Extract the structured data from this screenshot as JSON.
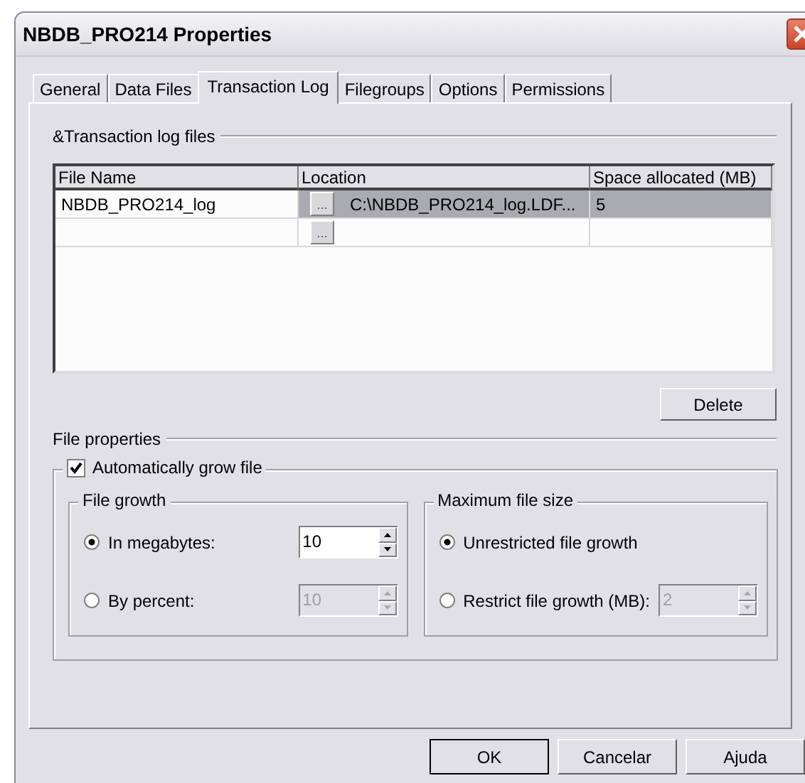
{
  "window": {
    "title": "NBDB_PRO214 Properties"
  },
  "tabs": [
    {
      "label": "General",
      "selected": false
    },
    {
      "label": "Data Files",
      "selected": false
    },
    {
      "label": "Transaction Log",
      "selected": true
    },
    {
      "label": "Filegroups",
      "selected": false
    },
    {
      "label": "Options",
      "selected": false
    },
    {
      "label": "Permissions",
      "selected": false
    }
  ],
  "log_files": {
    "label": "&Transaction log files",
    "columns": [
      "File Name",
      "Location",
      "Space allocated (MB)"
    ],
    "rows": [
      {
        "file_name": "NBDB_PRO214_log",
        "browse": "...",
        "location": "C:\\NBDB_PRO214_log.LDF...",
        "space": "5",
        "selected": true
      },
      {
        "browse": "...",
        "selected": false
      }
    ]
  },
  "delete_button": "Delete",
  "file_properties": {
    "label": "File properties",
    "auto_grow": {
      "label": "Automatically grow file",
      "checked": true
    },
    "file_growth": {
      "label": "File growth",
      "options": [
        {
          "label": "In megabytes:",
          "selected": true,
          "value": "10",
          "disabled": false
        },
        {
          "label": "By percent:",
          "selected": false,
          "value": "10",
          "disabled": true
        }
      ]
    },
    "max_size": {
      "label": "Maximum file size",
      "options": [
        {
          "label": "Unrestricted file growth",
          "selected": true
        },
        {
          "label": "Restrict file growth (MB):",
          "selected": false,
          "value": "2",
          "disabled": true
        }
      ]
    }
  },
  "buttons": [
    {
      "label": "OK",
      "default": true
    },
    {
      "label": "Cancelar",
      "default": false
    },
    {
      "label": "Ajuda",
      "default": false
    }
  ]
}
